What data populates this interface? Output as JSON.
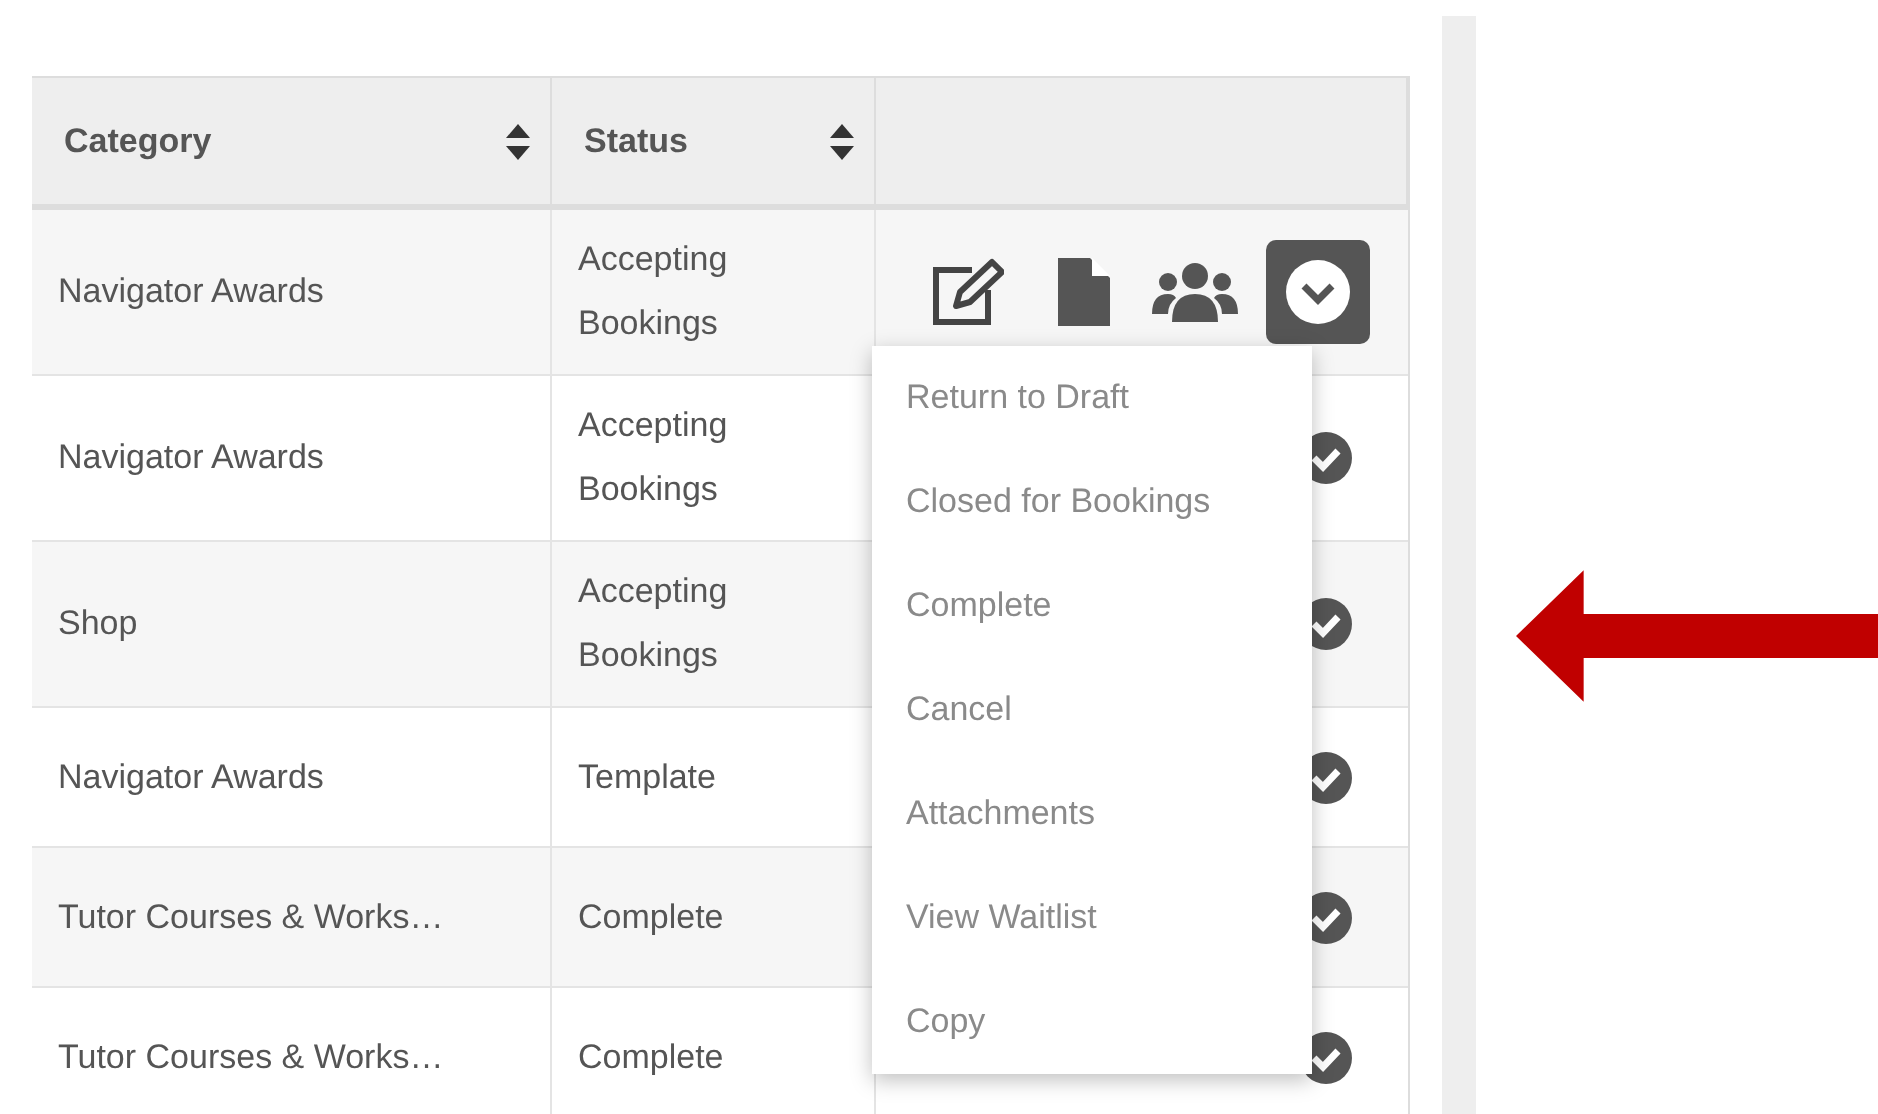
{
  "table": {
    "columns": [
      {
        "label": "Category",
        "sortable": true
      },
      {
        "label": "Status",
        "sortable": true
      },
      {
        "sortable": false
      }
    ],
    "rows": [
      {
        "category": "Navigator Awards",
        "status": "Accepting Bookings",
        "menu": {
          "expanded": true,
          "items": [
            "Return to Draft",
            "Closed for Bookings",
            "Complete",
            "Cancel",
            "Attachments",
            "View Waitlist",
            "Copy"
          ]
        }
      },
      {
        "category": "Navigator Awards",
        "status": "Accepting Bookings"
      },
      {
        "category": "Shop",
        "status": "Accepting Bookings"
      },
      {
        "category": "Navigator Awards",
        "status": "Template"
      },
      {
        "category": "Tutor Courses & Works…",
        "status": "Complete"
      },
      {
        "category": "Tutor Courses & Works…",
        "status": "Complete"
      }
    ]
  }
}
